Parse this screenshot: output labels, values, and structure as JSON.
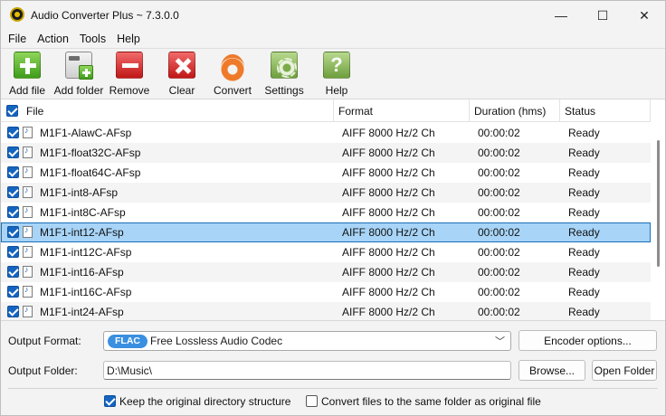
{
  "window": {
    "title": "Audio Converter Plus ~ 7.3.0.0",
    "controls": {
      "minimize": "—",
      "maximize": "☐",
      "close": "✕"
    }
  },
  "menu": [
    "File",
    "Action",
    "Tools",
    "Help"
  ],
  "toolbar": {
    "add_file": "Add file",
    "add_folder": "Add folder",
    "remove": "Remove",
    "clear": "Clear",
    "convert": "Convert",
    "settings": "Settings",
    "help": "Help",
    "help_glyph": "?"
  },
  "columns": {
    "file": "File",
    "format": "Format",
    "duration": "Duration (hms)",
    "status": "Status"
  },
  "rows": [
    {
      "file": "M1F1-AlawC-AFsp",
      "format": "AIFF 8000 Hz/2 Ch",
      "duration": "00:00:02",
      "status": "Ready",
      "checked": true
    },
    {
      "file": "M1F1-float32C-AFsp",
      "format": "AIFF 8000 Hz/2 Ch",
      "duration": "00:00:02",
      "status": "Ready",
      "checked": true
    },
    {
      "file": "M1F1-float64C-AFsp",
      "format": "AIFF 8000 Hz/2 Ch",
      "duration": "00:00:02",
      "status": "Ready",
      "checked": true
    },
    {
      "file": "M1F1-int8-AFsp",
      "format": "AIFF 8000 Hz/2 Ch",
      "duration": "00:00:02",
      "status": "Ready",
      "checked": true
    },
    {
      "file": "M1F1-int8C-AFsp",
      "format": "AIFF 8000 Hz/2 Ch",
      "duration": "00:00:02",
      "status": "Ready",
      "checked": true
    },
    {
      "file": "M1F1-int12-AFsp",
      "format": "AIFF 8000 Hz/2 Ch",
      "duration": "00:00:02",
      "status": "Ready",
      "checked": true,
      "selected": true
    },
    {
      "file": "M1F1-int12C-AFsp",
      "format": "AIFF 8000 Hz/2 Ch",
      "duration": "00:00:02",
      "status": "Ready",
      "checked": true
    },
    {
      "file": "M1F1-int16-AFsp",
      "format": "AIFF 8000 Hz/2 Ch",
      "duration": "00:00:02",
      "status": "Ready",
      "checked": true
    },
    {
      "file": "M1F1-int16C-AFsp",
      "format": "AIFF 8000 Hz/2 Ch",
      "duration": "00:00:02",
      "status": "Ready",
      "checked": true
    },
    {
      "file": "M1F1-int24-AFsp",
      "format": "AIFF 8000 Hz/2 Ch",
      "duration": "00:00:02",
      "status": "Ready",
      "checked": true
    }
  ],
  "output": {
    "format_label": "Output Format:",
    "format_badge": "FLAC",
    "format_value": "Free Lossless Audio Codec",
    "encoder_options": "Encoder options...",
    "folder_label": "Output Folder:",
    "folder_value": "D:\\Music\\",
    "browse": "Browse...",
    "open_folder": "Open Folder"
  },
  "options": {
    "keep_structure": "Keep the original directory structure",
    "keep_structure_checked": true,
    "same_folder": "Convert files to the same folder as original file",
    "same_folder_checked": false
  },
  "colors": {
    "accent": "#1565c0",
    "selection": "#a7d4f7",
    "flac_badge": "#3a8fe0"
  }
}
